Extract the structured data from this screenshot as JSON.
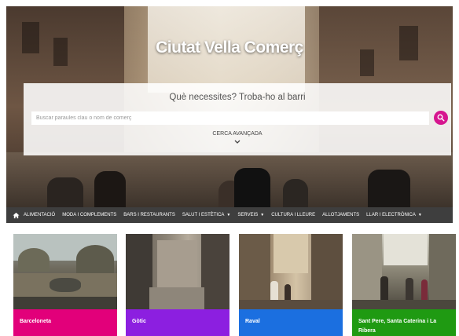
{
  "hero": {
    "title": "Ciutat Vella Comerç",
    "search_heading": "Què necessites? Troba-ho al barri",
    "search_placeholder": "Buscar paraules clau o nom de comerç",
    "advanced_label": "CERCA AVANÇADA",
    "search_icon": "search-icon",
    "chevron_icon": "chevron-down-icon"
  },
  "nav": {
    "home_icon": "home-icon",
    "items": [
      {
        "label": "ALIMENTACIÓ",
        "has_dropdown": false
      },
      {
        "label": "MODA I COMPLEMENTS",
        "has_dropdown": false
      },
      {
        "label": "BARS I RESTAURANTS",
        "has_dropdown": false
      },
      {
        "label": "SALUT I ESTÈTICA",
        "has_dropdown": true
      },
      {
        "label": "SERVEIS",
        "has_dropdown": true
      },
      {
        "label": "CULTURA I LLEURE",
        "has_dropdown": false
      },
      {
        "label": "ALLOTJAMENTS",
        "has_dropdown": false
      },
      {
        "label": "LLAR I ELECTRÒNICA",
        "has_dropdown": true
      }
    ]
  },
  "neighborhoods": [
    {
      "label": "Barceloneta",
      "color": "#e2007a"
    },
    {
      "label": "Gòtic",
      "color": "#8c1fe0"
    },
    {
      "label": "Raval",
      "color": "#1b6fe0"
    },
    {
      "label": "Sant Pere, Santa Caterina i La Ribera",
      "color": "#1f9a12"
    }
  ],
  "colors": {
    "accent": "#d6158f",
    "nav_bg": "#3e3e3e"
  }
}
